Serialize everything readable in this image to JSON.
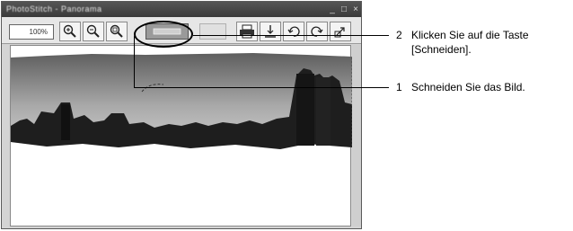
{
  "window": {
    "title": "PhotoStitch - Panorama",
    "controls": [
      "_",
      "□",
      "×"
    ]
  },
  "toolbar": {
    "zoom_value": "100%",
    "buttons": [
      "zoom-in",
      "zoom-out",
      "zoom-fit",
      "crop",
      "print",
      "save",
      "rotate-left",
      "rotate-right",
      "help"
    ]
  },
  "callouts": [
    {
      "number": "2",
      "line1": "Klicken Sie auf die Taste",
      "line2": "[Schneiden]."
    },
    {
      "number": "1",
      "line1": "Schneiden Sie das Bild.",
      "line2": ""
    }
  ]
}
